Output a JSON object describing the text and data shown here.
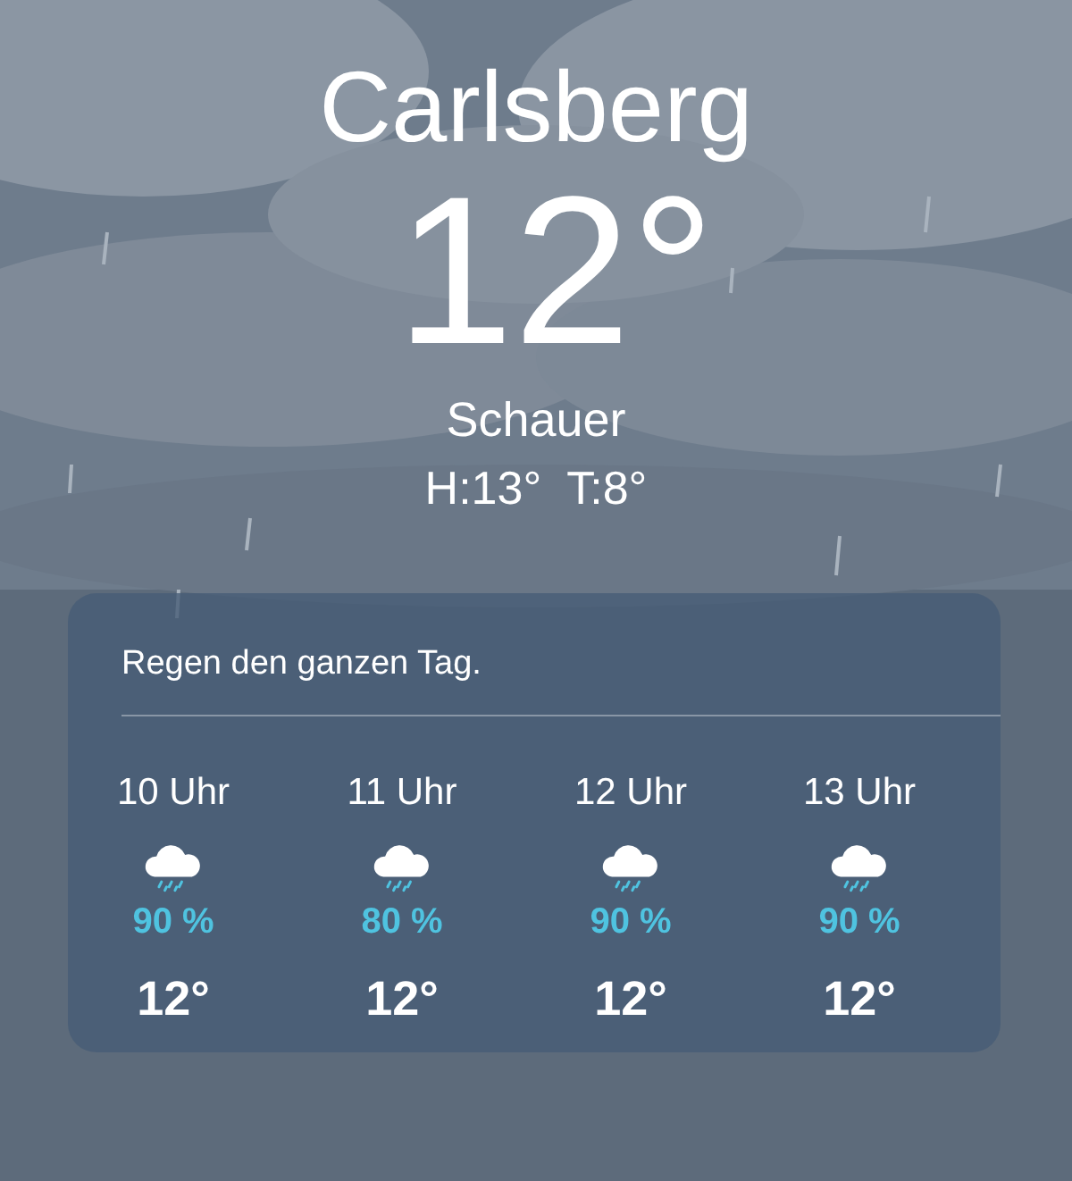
{
  "location": {
    "city": "Carlsberg",
    "temperature": "12°",
    "condition": "Schauer",
    "high_low": "H:13°  T:8°"
  },
  "hourly_card": {
    "summary": "Regen den ganzen Tag.",
    "hours": [
      {
        "time": "10 Uhr",
        "precipitation": "90 %",
        "temperature": "12°"
      },
      {
        "time": "11 Uhr",
        "precipitation": "80 %",
        "temperature": "12°"
      },
      {
        "time": "12 Uhr",
        "precipitation": "90 %",
        "temperature": "12°"
      },
      {
        "time": "13 Uhr",
        "precipitation": "90 %",
        "temperature": "12°"
      }
    ]
  }
}
